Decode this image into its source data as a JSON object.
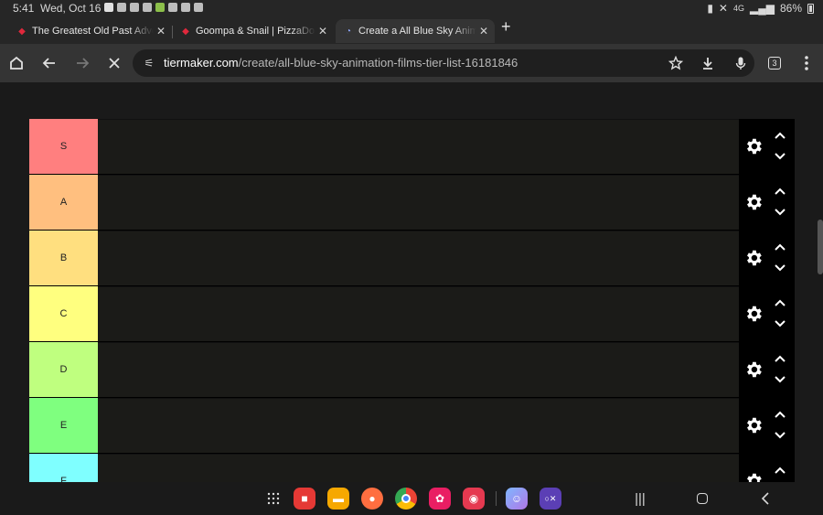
{
  "status_bar": {
    "time": "5:41",
    "date": "Wed, Oct 16",
    "network": "4G",
    "battery": "86%"
  },
  "tabs": [
    {
      "title": "The Greatest Old Past Adventures",
      "favicon": "pizza-icon",
      "active": false
    },
    {
      "title": "Goompa & Snail | PizzaDome",
      "favicon": "pizza-icon",
      "active": false
    },
    {
      "title": "Create a All Blue Sky Animation Films Tier List",
      "favicon": "loading-spinner-icon",
      "active": true
    }
  ],
  "toolbar": {
    "url_host": "tiermaker.com",
    "url_path": "/create/all-blue-sky-animation-films-tier-list-16181846",
    "tab_count": "3"
  },
  "tiers": [
    {
      "label": "S",
      "color": "#ff7f7f"
    },
    {
      "label": "A",
      "color": "#ffbf7f"
    },
    {
      "label": "B",
      "color": "#ffdf7f"
    },
    {
      "label": "C",
      "color": "#ffff7f"
    },
    {
      "label": "D",
      "color": "#bfff7f"
    },
    {
      "label": "E",
      "color": "#7fff7f"
    },
    {
      "label": "F",
      "color": "#7fffff"
    }
  ],
  "dock": {
    "apps": [
      "apps-grid-icon",
      "flipboard-icon",
      "files-icon",
      "contacts-icon",
      "chrome-icon",
      "flower-app-icon",
      "camera-icon",
      "game-avatar-icon",
      "game-launcher-icon"
    ]
  }
}
